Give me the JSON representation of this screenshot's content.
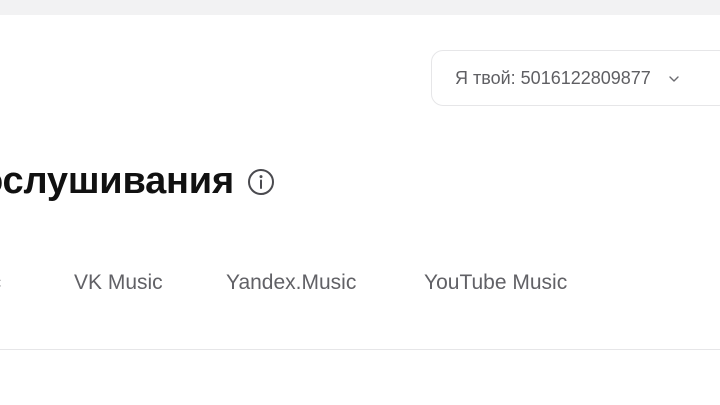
{
  "account_selector": {
    "label": "Я твой: 5016122809877",
    "icon": "chevron-down-icon"
  },
  "page": {
    "title": "ослушивания",
    "title_icon": "info-icon"
  },
  "tabs": [
    {
      "label": "ic"
    },
    {
      "label": "VK Music"
    },
    {
      "label": "Yandex.Music"
    },
    {
      "label": "YouTube Music"
    }
  ],
  "colors": {
    "top_strip": "#f2f2f3",
    "border": "#e6e6e8",
    "tab_text": "#616166",
    "title_text": "#111111"
  }
}
